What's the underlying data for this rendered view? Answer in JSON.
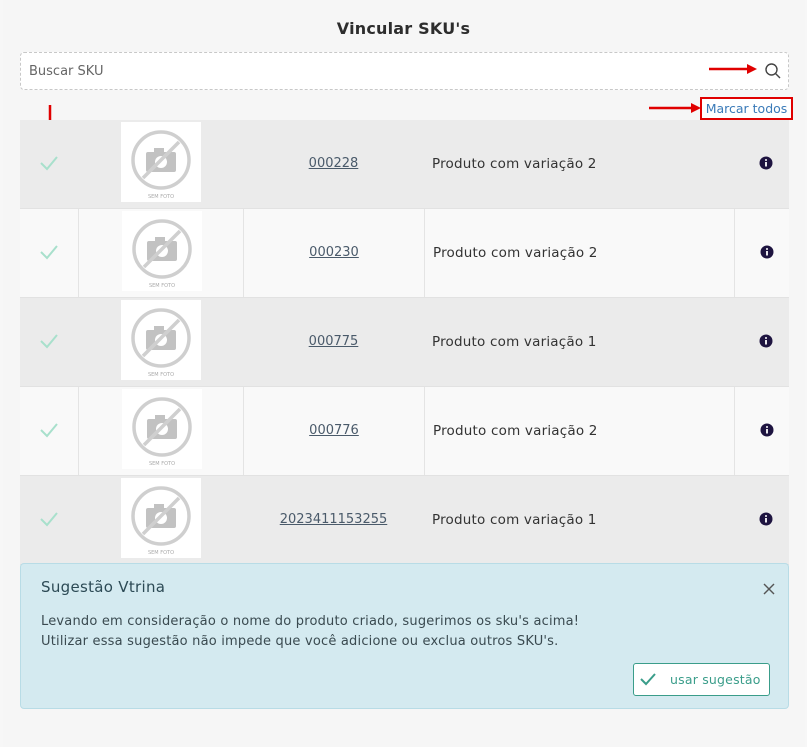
{
  "page": {
    "title": "Vincular SKU's"
  },
  "search": {
    "placeholder": "Buscar SKU",
    "value": ""
  },
  "actions": {
    "mark_all_label": "Marcar todos"
  },
  "thumbnail": {
    "caption": "SEM FOTO"
  },
  "rows": [
    {
      "sku": "000228",
      "name": "Produto com variação 2",
      "checked": true
    },
    {
      "sku": "000230",
      "name": "Produto com variação 2",
      "checked": true
    },
    {
      "sku": "000775",
      "name": "Produto com variação 1",
      "checked": true
    },
    {
      "sku": "000776",
      "name": "Produto com variação 2",
      "checked": true
    },
    {
      "sku": "2023411153255",
      "name": "Produto com variação 1",
      "checked": true
    }
  ],
  "suggestion": {
    "title": "Sugestão Vtrina",
    "line1": "Levando em consideração o nome do produto criado, sugerimos os sku's acima!",
    "line2": "Utilizar essa sugestão não impede que você adicione ou exclua outros SKU's.",
    "button_label": "usar sugestão"
  },
  "colors": {
    "accent_red": "#e00000",
    "check_green": "#a8e0cc",
    "button_green": "#3a9d8a",
    "suggestion_bg": "#d4eaf0",
    "info_icon": "#1e1440"
  },
  "icons": [
    "search-icon",
    "check-icon",
    "no-photo-icon",
    "info-icon",
    "close-icon",
    "annotation-arrow"
  ]
}
